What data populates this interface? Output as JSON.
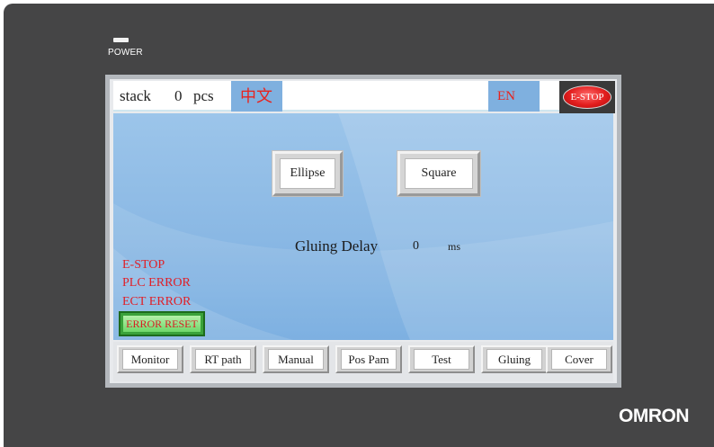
{
  "device": {
    "power_label": "POWER",
    "brand": "OMRON"
  },
  "topbar": {
    "stack_label": "stack",
    "stack_count": "0",
    "stack_unit": "pcs",
    "lang_cn": "中文",
    "lang_en": "EN",
    "estop_label": "E-STOP"
  },
  "main": {
    "ellipse_label": "Ellipse",
    "square_label": "Square",
    "gluing_delay_label": "Gluing Delay",
    "gluing_delay_value": "0",
    "gluing_delay_unit": "ms"
  },
  "errors": {
    "items": [
      "E-STOP",
      "PLC ERROR",
      "ECT ERROR"
    ],
    "reset_label": "ERROR RESET"
  },
  "navbar": {
    "items": [
      "Monitor",
      "RT path",
      "Manual",
      "Pos Pam",
      "Test",
      "Gluing",
      "Cover"
    ]
  },
  "colors": {
    "bezel": "#454546",
    "screen_blue": "#8ab8e4",
    "alarm_red": "#e01f27",
    "reset_green": "#3aa23a"
  }
}
